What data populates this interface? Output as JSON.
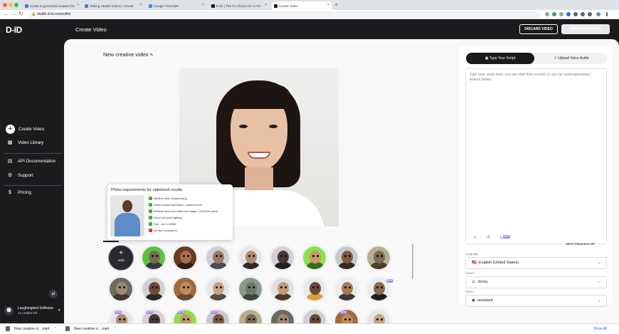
{
  "browser": {
    "tabs": [
      {
        "title": "create ai generated avatars fro",
        "color": "#4a7bd0"
      },
      {
        "title": "Talking Heads Videos | Create",
        "color": "#4a7bd0"
      },
      {
        "title": "Google Translate",
        "color": "#4285f4"
      },
      {
        "title": "D-ID | The #1 Choice for AI Ge",
        "color": "#1b1b1e"
      },
      {
        "title": "Create Video",
        "color": "#1b1b1e"
      }
    ],
    "url": "studio.d-id.com/editor"
  },
  "header": {
    "logo": "D-ID",
    "title": "Create Video",
    "discard_label": "DISCARD VIDEO",
    "generate_label": "GENERATE VIDEO"
  },
  "sidebar": {
    "items": [
      {
        "label": "Create Video",
        "icon": "plus-icon"
      },
      {
        "label": "Video Library",
        "icon": "grid-icon"
      },
      {
        "label": "API Documentation",
        "icon": "document-icon"
      },
      {
        "label": "Support",
        "icon": "gear-icon"
      },
      {
        "label": "Pricing",
        "icon": "dollar-icon"
      }
    ],
    "account": {
      "name": "Laughingbird Software",
      "credits": "14 credits left"
    }
  },
  "main": {
    "video_title": "New creative video",
    "requirements": {
      "title": "Photo requirements for optimized results",
      "items": [
        {
          "text": "Medium shot, frontal facing",
          "ok": true
        },
        {
          "text": "Neutral facial expression, closed mouth",
          "ok": true
        },
        {
          "text": "Minimal head size within the image - 200X200 pixels",
          "ok": true
        },
        {
          "text": "Good and solid lighting",
          "ok": true
        },
        {
          "text": "Size - up to 10MB",
          "ok": true
        },
        {
          "text": "No face occlusions",
          "ok": false
        }
      ]
    },
    "add_label": "ADD",
    "new_badge": "NEW"
  },
  "script": {
    "tab_type": "Type Your Script",
    "tab_upload": "Upload Voice Audio",
    "placeholder": "Type your script here, you can start from scratch or use our script-generation feature below.",
    "char_count": "3875 Characters left",
    "language": {
      "label": "Language",
      "value": "English (United States)"
    },
    "voices": {
      "label": "Voices",
      "value": "Jenny"
    },
    "styles": {
      "label": "Styles",
      "value": "assistant"
    }
  },
  "downloads": {
    "items": [
      "New creative vi....mp4",
      "New creative vi....mp4"
    ],
    "show_all": "Show All"
  }
}
